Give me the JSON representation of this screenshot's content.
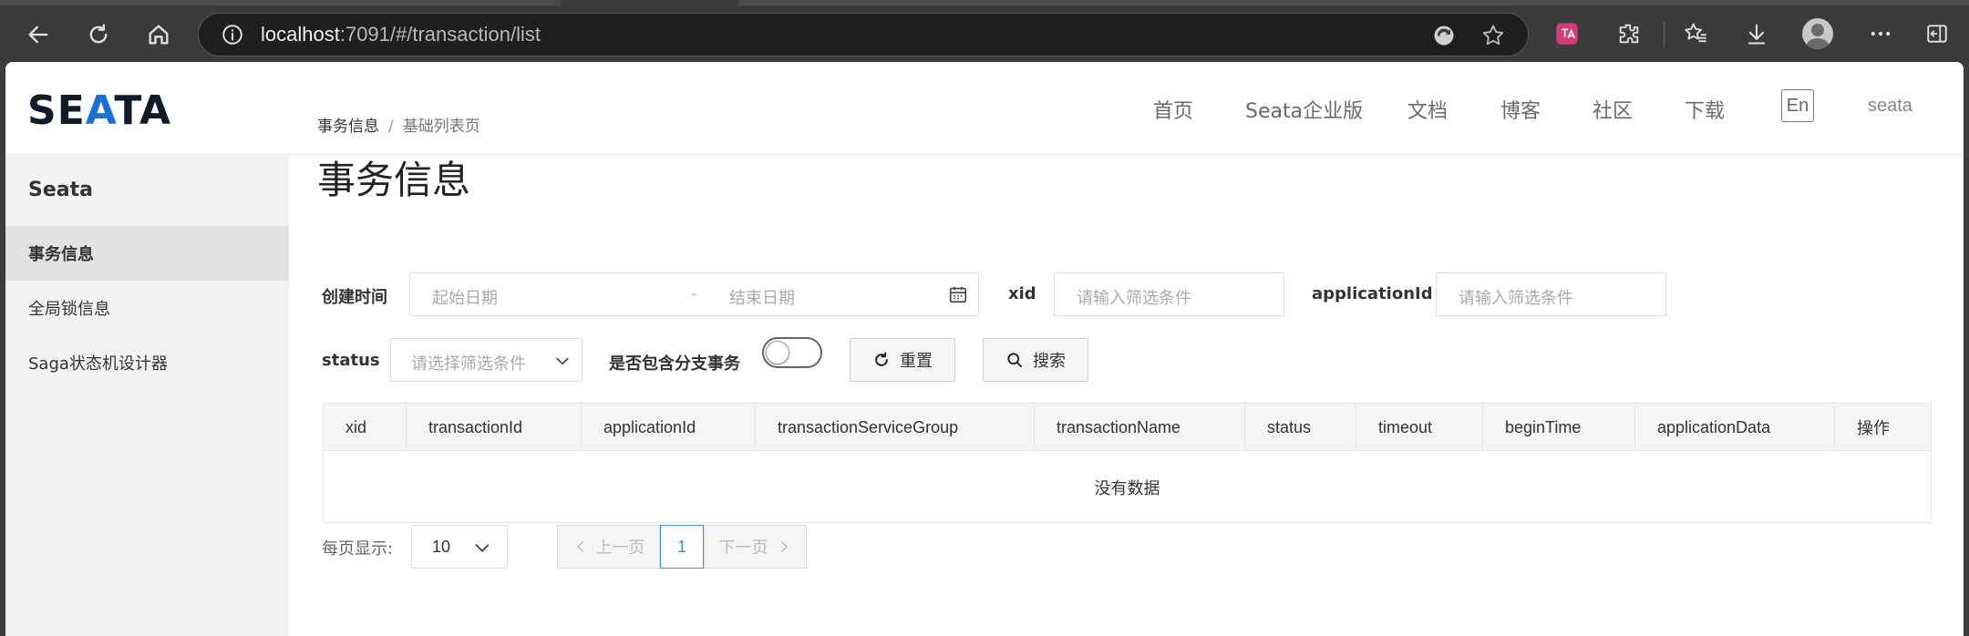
{
  "browser": {
    "url_host": "localhost",
    "url_path": ":7091/#/transaction/list"
  },
  "header": {
    "logo": {
      "left": "SE",
      "accent": "A",
      "right": "TA"
    },
    "nav": [
      "首页",
      "Seata企业版",
      "文档",
      "博客",
      "社区",
      "下载"
    ],
    "lang": "En",
    "user": "seata"
  },
  "sidebar": {
    "title": "Seata",
    "items": [
      {
        "label": "事务信息",
        "active": true
      },
      {
        "label": "全局锁信息",
        "active": false
      },
      {
        "label": "Saga状态机设计器",
        "active": false
      }
    ]
  },
  "breadcrumb": {
    "first": "事务信息",
    "sep": "/",
    "second": "基础列表页"
  },
  "page_title": "事务信息",
  "filters": {
    "create_time_label": "创建时间",
    "start_placeholder": "起始日期",
    "range_sep": "-",
    "end_placeholder": "结束日期",
    "xid_label": "xid",
    "xid_placeholder": "请输入筛选条件",
    "app_label": "applicationId",
    "app_placeholder": "请输入筛选条件",
    "status_label": "status",
    "status_placeholder": "请选择筛选条件",
    "branch_label": "是否包含分支事务",
    "branch_enabled": false,
    "reset_label": "重置",
    "search_label": "搜索"
  },
  "table": {
    "columns": [
      "xid",
      "transactionId",
      "applicationId",
      "transactionServiceGroup",
      "transactionName",
      "status",
      "timeout",
      "beginTime",
      "applicationData",
      "操作"
    ],
    "empty_text": "没有数据"
  },
  "pagination": {
    "page_size_label": "每页显示:",
    "page_size": "10",
    "prev": "上一页",
    "current": "1",
    "next": "下一页"
  },
  "colors": {
    "accent": "#1a6fd8",
    "current_page": "#3e8fe0"
  }
}
